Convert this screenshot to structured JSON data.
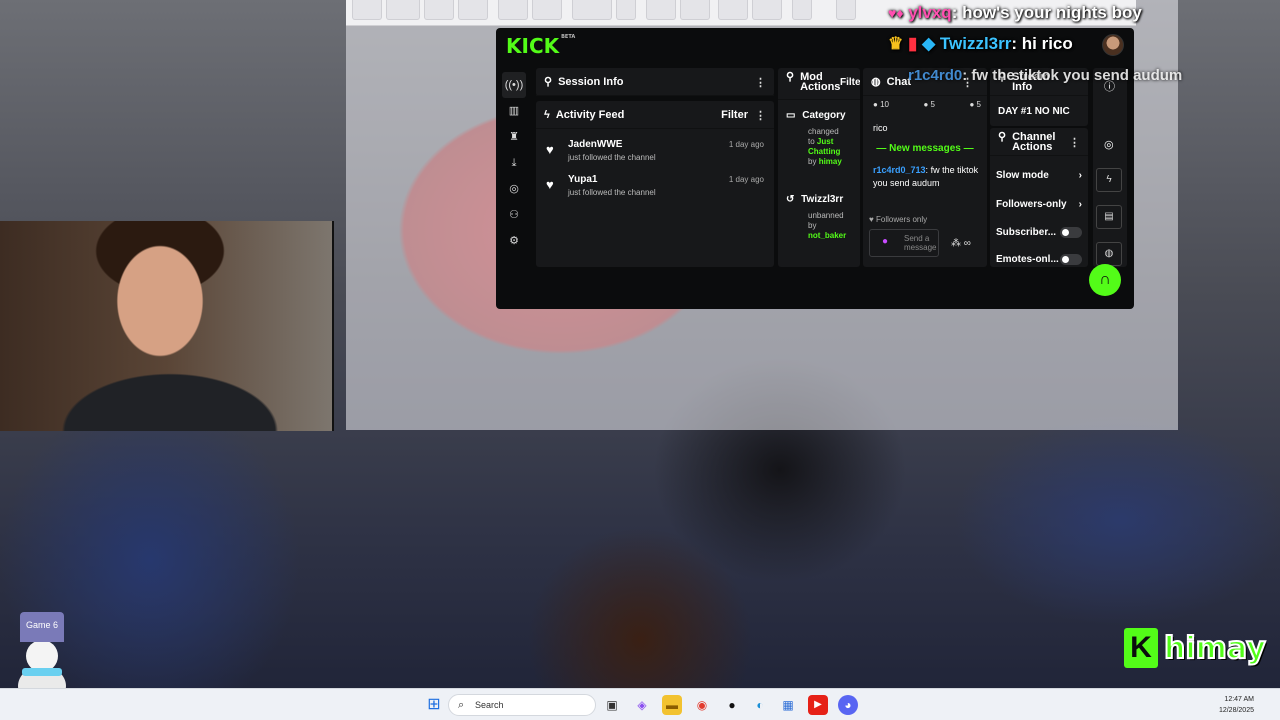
{
  "overlay_chat": {
    "top_user": "ylvxq",
    "top_message": "how's your nights boy",
    "mid_user": "Twizzl3rr",
    "mid_message": "hi rico",
    "ghost_user": "r1c4rd0",
    "ghost_message": "fw the tiktok you send audum"
  },
  "kick": {
    "logo": "KICK",
    "logo_tag": "BETA",
    "rail_icons": [
      "broadcast-icon",
      "chart-icon",
      "trophy-icon",
      "download-icon",
      "target-icon",
      "users-icon",
      "gear-icon"
    ],
    "session_info": {
      "title": "Session Info"
    },
    "activity_feed": {
      "title": "Activity Feed",
      "filter_label": "Filter",
      "items": [
        {
          "name": "JadenWWE",
          "action": "just followed the channel",
          "time": "1 day ago"
        },
        {
          "name": "Yupa1",
          "action": "just followed the channel",
          "time": "1 day ago"
        }
      ]
    },
    "mod_actions": {
      "title": "Mod Actions",
      "filter_label": "Filter",
      "entries": [
        {
          "title": "Category",
          "lines": [
            "changed",
            "to"
          ],
          "highlight": "Just Chatting",
          "by_label": "by",
          "by": "himay"
        },
        {
          "title": "Twizzl3rr",
          "lines": [
            "unbanned",
            "by"
          ],
          "highlight": "",
          "by_label": "",
          "by": "not_baker"
        }
      ]
    },
    "chat": {
      "title": "Chat",
      "stats": [
        "10",
        "5",
        "5"
      ],
      "prev_text": "rico",
      "new_messages_label": "New messages",
      "message_user": "r1c4rd0_713",
      "message_text": "fw the tiktok you send audum",
      "followers_only": "Followers only",
      "send_placeholder": "Send a message"
    },
    "stream_info": {
      "title": "Stream Info",
      "stream_title": "DAY #1 NO NIC"
    },
    "channel_actions": {
      "title": "Channel Actions",
      "rows": [
        {
          "label": "Slow mode",
          "control": "arrow"
        },
        {
          "label": "Followers-only",
          "control": "arrow"
        },
        {
          "label": "Subscriber...",
          "control": "toggle"
        },
        {
          "label": "Emotes-onl...",
          "control": "toggle"
        }
      ]
    }
  },
  "brand": {
    "logo_letter": "K",
    "name": "himay"
  },
  "snowman_hat": "Game 6",
  "taskbar": {
    "search_placeholder": "Search",
    "time": "12:47 AM",
    "date": "12/28/2025",
    "icons": [
      "windows-icon",
      "task-view-icon",
      "copilot-icon",
      "file-explorer-icon",
      "chrome-icon",
      "obs-icon",
      "edge-icon",
      "store-icon",
      "youtube-icon",
      "discord-icon"
    ]
  },
  "colors": {
    "kick_green": "#53fc18",
    "panel": "#17181a",
    "bg": "#0b0c0d"
  }
}
